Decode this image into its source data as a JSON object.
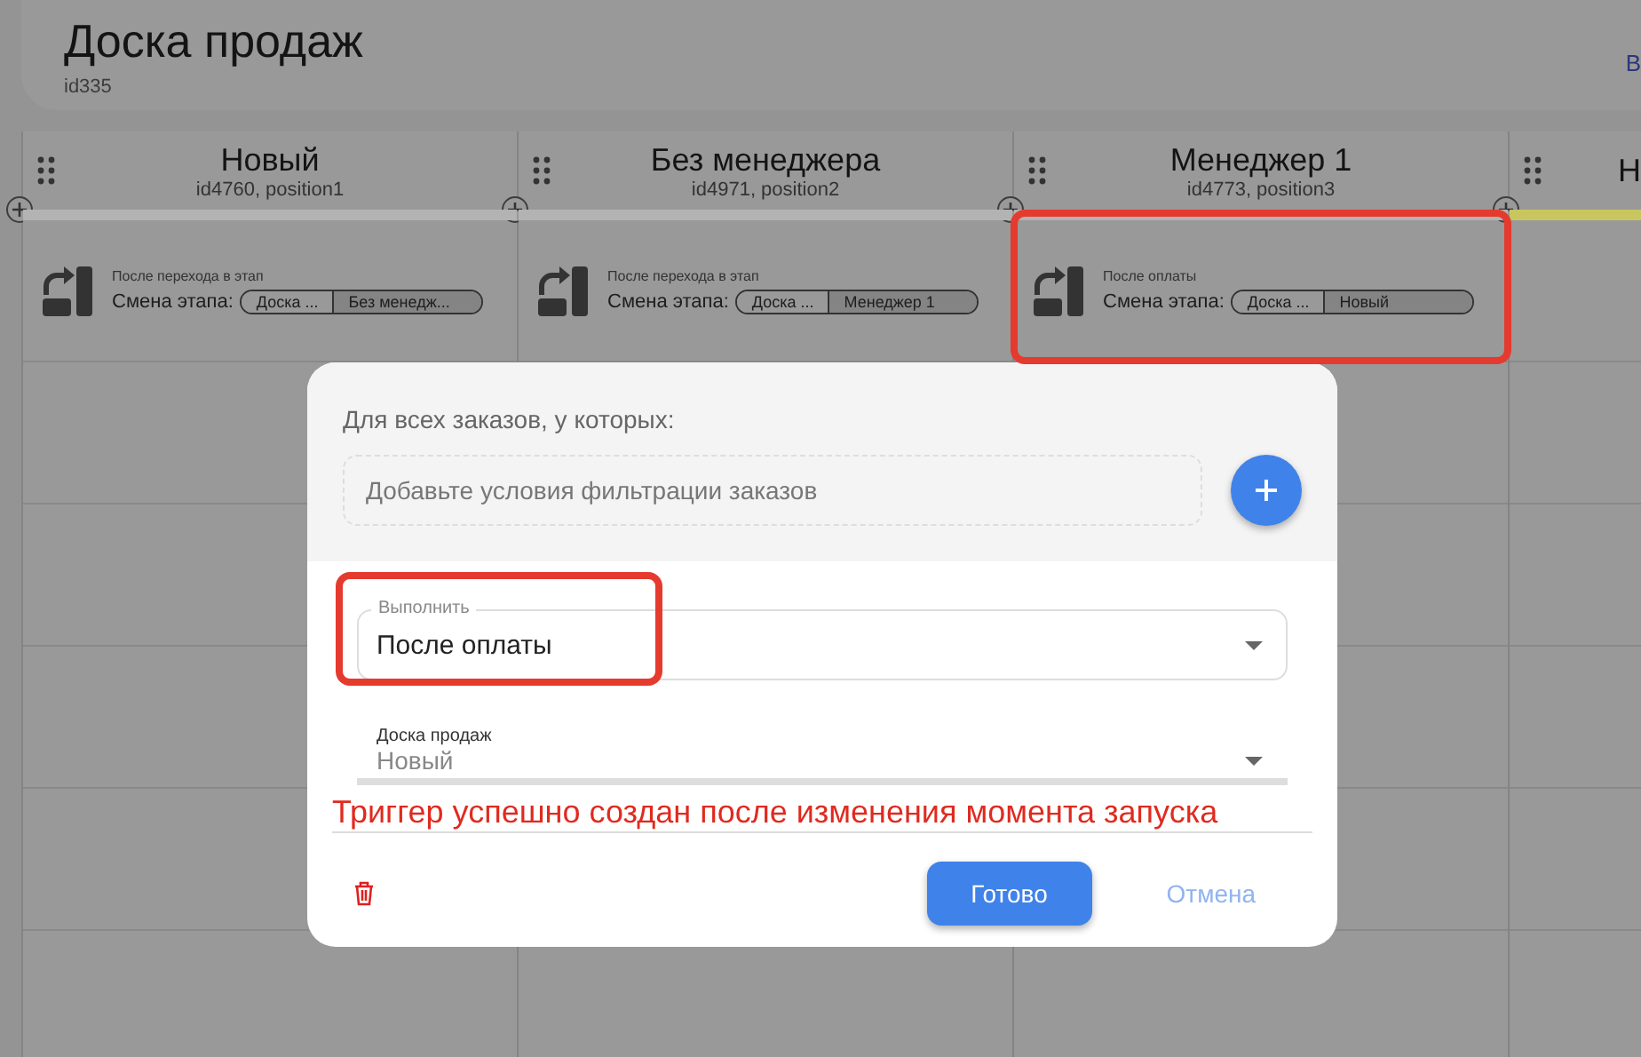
{
  "board": {
    "title": "Доска продаж",
    "subtitle": "id335",
    "action_partial": "В"
  },
  "columns": [
    {
      "title": "Новый",
      "subtitle": "id4760, position1",
      "color": "#b3b3b3",
      "trigger": {
        "event": "После перехода в этап",
        "label": "Смена этапа:",
        "board": "Доска ...",
        "stage": "Без менедж..."
      },
      "highlighted": false
    },
    {
      "title": "Без менеджера",
      "subtitle": "id4971, position2",
      "color": "#b3b3b3",
      "trigger": {
        "event": "После перехода в этап",
        "label": "Смена этапа:",
        "board": "Доска ...",
        "stage": "Менеджер 1"
      },
      "highlighted": false
    },
    {
      "title": "Менеджер 1",
      "subtitle": "id4773, position3",
      "color": "#b3b3b3",
      "trigger": {
        "event": "После оплаты",
        "label": "Смена этапа:",
        "board": "Доска ...",
        "stage": "Новый"
      },
      "highlighted": true
    },
    {
      "title": "Н",
      "color": "#c9c65f",
      "highlighted": false
    }
  ],
  "modal": {
    "filter_label": "Для всех заказов, у которых:",
    "filter_placeholder": "Добавьте условия фильтрации заказов",
    "execute": {
      "label": "Выполнить",
      "value": "После оплаты",
      "highlighted": true
    },
    "board_select": {
      "label": "Доска продаж",
      "value": "Новый"
    },
    "note": "Триггер успешно создан после изменения момента запуска",
    "buttons": {
      "done": "Готово",
      "cancel": "Отмена"
    }
  }
}
